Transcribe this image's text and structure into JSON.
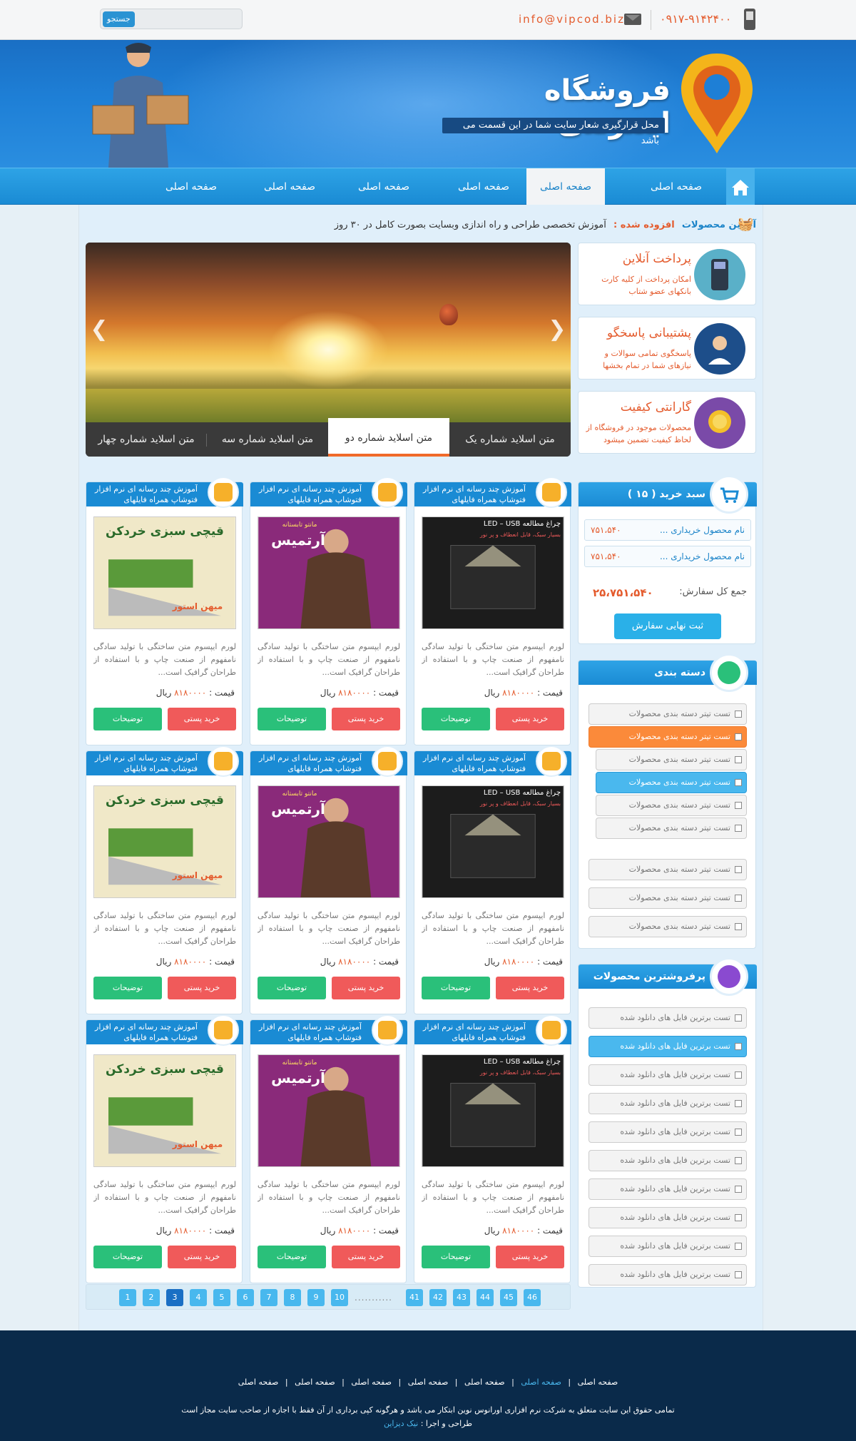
{
  "header": {
    "search_button": "جستجو",
    "email": "info@vipcod.biz",
    "phone": "۰۹۱۷-۹۱۴۲۴۰۰",
    "site_title": "فروشگاه اینترنتی",
    "slogan": "محل قرارگیری شعار سایت شما در این قسمت می باشد"
  },
  "nav": {
    "items": [
      "صفحه اصلی",
      "صفحه اصلی",
      "صفحه اصلی",
      "صفحه اصلی",
      "صفحه اصلی",
      "صفحه اصلی"
    ]
  },
  "news": {
    "label": "آخرین محصولات",
    "added": "افزوده شده :",
    "text": "آموزش تخصصی طراحی و راه اندازی وبسایت بصورت کامل در ۳۰ روز"
  },
  "slider": {
    "tabs": [
      "متن اسلاید شماره یک",
      "متن اسلاید شماره دو",
      "متن اسلاید شماره سه",
      "متن اسلاید شماره چهار"
    ]
  },
  "features": [
    {
      "title": "پرداخت آنلاین",
      "desc": "امکان پرداخت از کلیه کارت بانکهای عضو شتاب"
    },
    {
      "title": "پشتیبانی پاسخگو",
      "desc": "پاسخگوی تمامی سوالات و نیازهای شما در تمام بخشها"
    },
    {
      "title": "گارانتی کیفیت",
      "desc": "محصولات موجود در فروشگاه از لحاظ کیفیت تضمین میشود"
    }
  ],
  "cart": {
    "title": "سبد خرید ( ۱۵ )",
    "items": [
      {
        "name": "نام محصول خریداری ...",
        "price": "۷۵۱،۵۴۰"
      },
      {
        "name": "نام محصول خریداری ...",
        "price": "۷۵۱،۵۴۰"
      }
    ],
    "total_label": "جمع کل سفارش:",
    "total_value": "۲۵،۷۵۱،۵۴۰",
    "checkout": "ثبت نهایی سفارش"
  },
  "categories": {
    "title": "دسته بندی",
    "items": [
      "تست تیتر دسته بندی محصولات",
      "تست تیتر دسته بندی محصولات",
      "تست تیتر دسته بندی محصولات",
      "تست تیتر دسته بندی محصولات",
      "تست تیتر دسته بندی محصولات",
      "تست تیتر دسته بندی محصولات",
      "تست تیتر دسته بندی محصولات",
      "تست تیتر دسته بندی محصولات",
      "تست تیتر دسته بندی محصولات"
    ]
  },
  "bestsellers": {
    "title": "پرفروشترین محصولات",
    "items": [
      "تست برترین فایل های دانلود شده",
      "تست برترین فایل های دانلود شده",
      "تست برترین فایل های دانلود شده",
      "تست برترین فایل های دانلود شده",
      "تست برترین فایل های دانلود شده",
      "تست برترین فایل های دانلود شده",
      "تست برترین فایل های دانلود شده",
      "تست برترین فایل های دانلود شده",
      "تست برترین فایل های دانلود شده",
      "تست برترین فایل های دانلود شده"
    ]
  },
  "products": {
    "title": "آموزش چند رسانه ای نرم افزار فتوشاپ همراه فایلهای آموزشی...",
    "desc": "لورم ایپسوم متن ساختگی با تولید سادگی نامفهوم از صنعت چاپ و با استفاده از طراحان گرافیک است...",
    "price_label": "قیمت :",
    "price": "۸۱۸۰۰۰۰",
    "currency": "ریال",
    "buy": "خرید پستی",
    "details": "توضیحات",
    "img_lamp": "چراغ مطالعه LED – USB",
    "img_lamp_sub": "بسیار سبک، قابل انعطاف و پر نور",
    "img_dress": "آرتمیس",
    "img_dress_top": "مانتو تابستانه",
    "img_scissors": "قیچی سبزی خردکن",
    "img_scissors_brand": "میهن استور"
  },
  "pagination": {
    "pages": [
      "1",
      "2",
      "3",
      "4",
      "5",
      "6",
      "7",
      "8",
      "9",
      "10",
      "41",
      "42",
      "43",
      "44",
      "45",
      "46"
    ],
    "current": "3",
    "ellipsis": "..........."
  },
  "footer": {
    "links": [
      "صفحه اصلی",
      "صفحه اصلی",
      "صفحه اصلی",
      "صفحه اصلی",
      "صفحه اصلی",
      "صفحه اصلی",
      "صفحه اصلی"
    ],
    "copyright": "تمامی حقوق این سایت متعلق به شرکت نرم افزاری اورانوس نوین ابتکار می باشد و هرگونه کپی برداری از آن فقط با اجازه از صاحب سایت مجاز است",
    "credit_label": "طراحی و اجرا :",
    "credit_name": "نیک دیزاین"
  }
}
